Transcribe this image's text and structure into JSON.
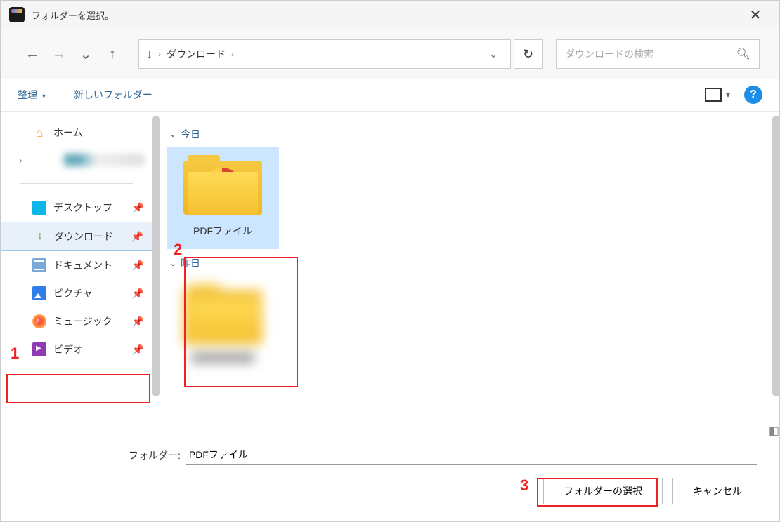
{
  "title": "フォルダーを選択。",
  "nav": {
    "breadcrumb": "ダウンロード",
    "search_placeholder": "ダウンロードの検索"
  },
  "toolbar": {
    "organize": "整理",
    "new_folder": "新しいフォルダー"
  },
  "sidebar": {
    "home": "ホーム",
    "items": [
      {
        "label": "デスクトップ"
      },
      {
        "label": "ダウンロード"
      },
      {
        "label": "ドキュメント"
      },
      {
        "label": "ピクチャ"
      },
      {
        "label": "ミュージック"
      },
      {
        "label": "ビデオ"
      }
    ]
  },
  "content": {
    "groups": [
      {
        "label": "今日",
        "items": [
          {
            "name": "PDFファイル"
          }
        ]
      },
      {
        "label": "昨日",
        "items": [
          {
            "name": ""
          }
        ]
      }
    ]
  },
  "footer": {
    "folder_label": "フォルダー:",
    "folder_value": "PDFファイル",
    "select_btn": "フォルダーの選択",
    "cancel_btn": "キャンセル"
  },
  "annotations": {
    "a1": "1",
    "a2": "2",
    "a3": "3"
  }
}
